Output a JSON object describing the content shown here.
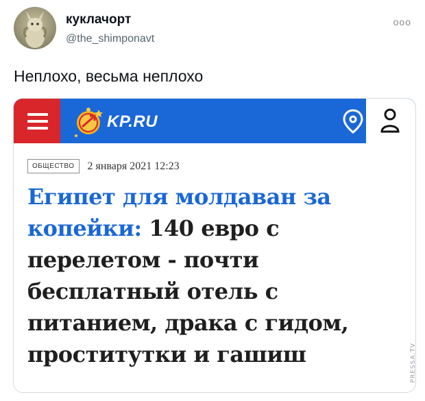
{
  "tweet": {
    "author_name": "куклачорт",
    "author_handle": "@the_shimponavt",
    "more_icon": "ooo",
    "text": "Неплохо, весьма неплохо"
  },
  "card": {
    "site": {
      "logo_text": "KP.RU",
      "icons": [
        "menu-icon",
        "location-pin-icon",
        "user-icon"
      ],
      "colors": {
        "header_blue": "#1a67d8",
        "menu_red": "#d9262b"
      }
    },
    "article": {
      "category": "ОБЩЕСТВО",
      "date": "2 января 2021 12:23",
      "headline_accent": "Египет для молдаван за копейки:",
      "headline_rest": " 140 евро с перелетом - почти бесплатный отель с питанием, драка с гидом, проститутки и гашиш"
    }
  },
  "watermark": "PRESSA.TV"
}
